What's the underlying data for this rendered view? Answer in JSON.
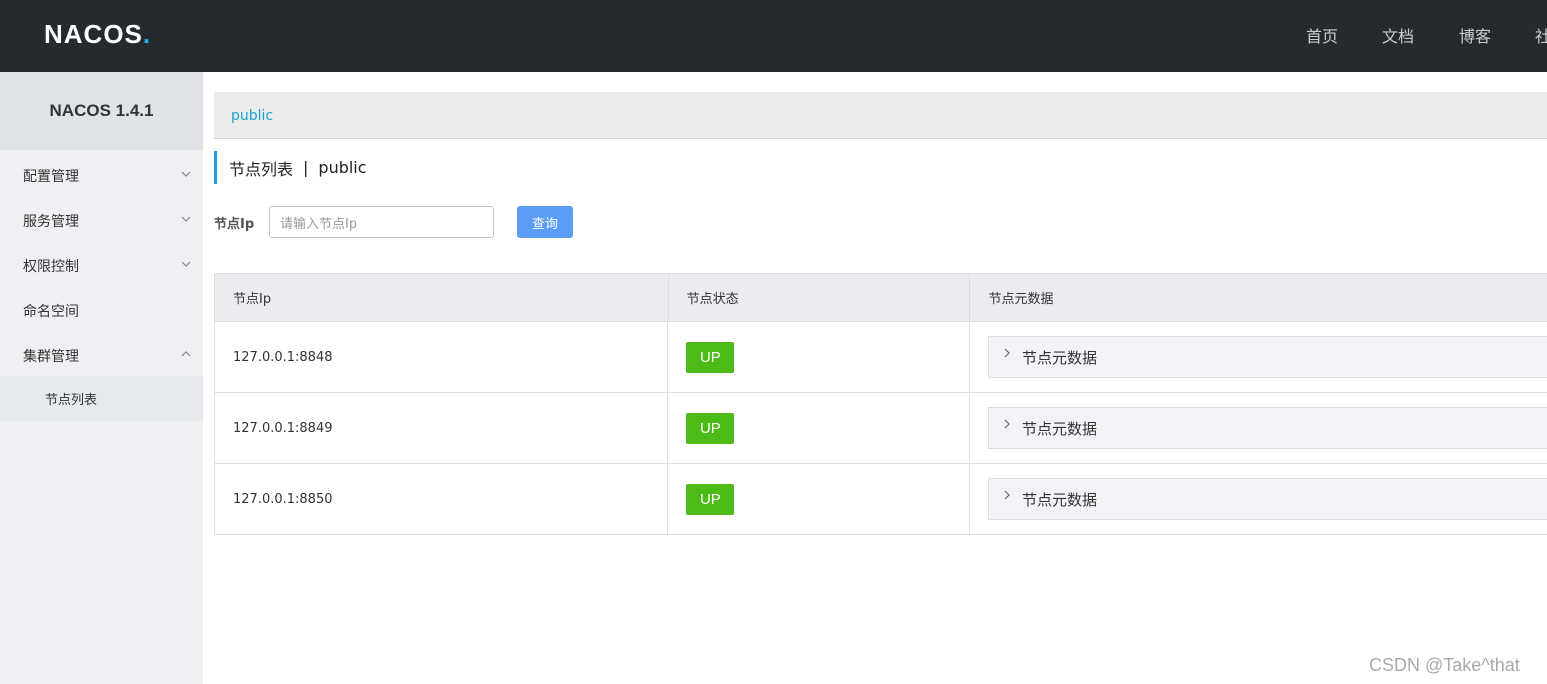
{
  "header": {
    "logo": "NACOS",
    "logo_dot": ".",
    "nav": [
      "首页",
      "文档",
      "博客",
      "社"
    ]
  },
  "sidebar": {
    "version": "NACOS 1.4.1",
    "items": [
      {
        "label": "配置管理",
        "expandable": true,
        "expanded": false
      },
      {
        "label": "服务管理",
        "expandable": true,
        "expanded": false
      },
      {
        "label": "权限控制",
        "expandable": true,
        "expanded": false
      },
      {
        "label": "命名空间",
        "expandable": false
      },
      {
        "label": "集群管理",
        "expandable": true,
        "expanded": true
      }
    ],
    "subitem": "节点列表"
  },
  "namespace_bar": {
    "active": "public"
  },
  "page_title": {
    "title": "节点列表",
    "separator": "|",
    "namespace": "public"
  },
  "search": {
    "label": "节点Ip",
    "placeholder": "请输入节点Ip",
    "button": "查询"
  },
  "table": {
    "headers": [
      "节点Ip",
      "节点状态",
      "节点元数据"
    ],
    "rows": [
      {
        "ip": "127.0.0.1:8848",
        "status": "UP",
        "meta": "节点元数据"
      },
      {
        "ip": "127.0.0.1:8849",
        "status": "UP",
        "meta": "节点元数据"
      },
      {
        "ip": "127.0.0.1:8850",
        "status": "UP",
        "meta": "节点元数据"
      }
    ]
  },
  "watermark": "CSDN @Take^that",
  "colors": {
    "topbar": "#252a2f",
    "accent": "#209bd9",
    "status_up": "#4cbb17",
    "button": "#5b9cf6"
  }
}
